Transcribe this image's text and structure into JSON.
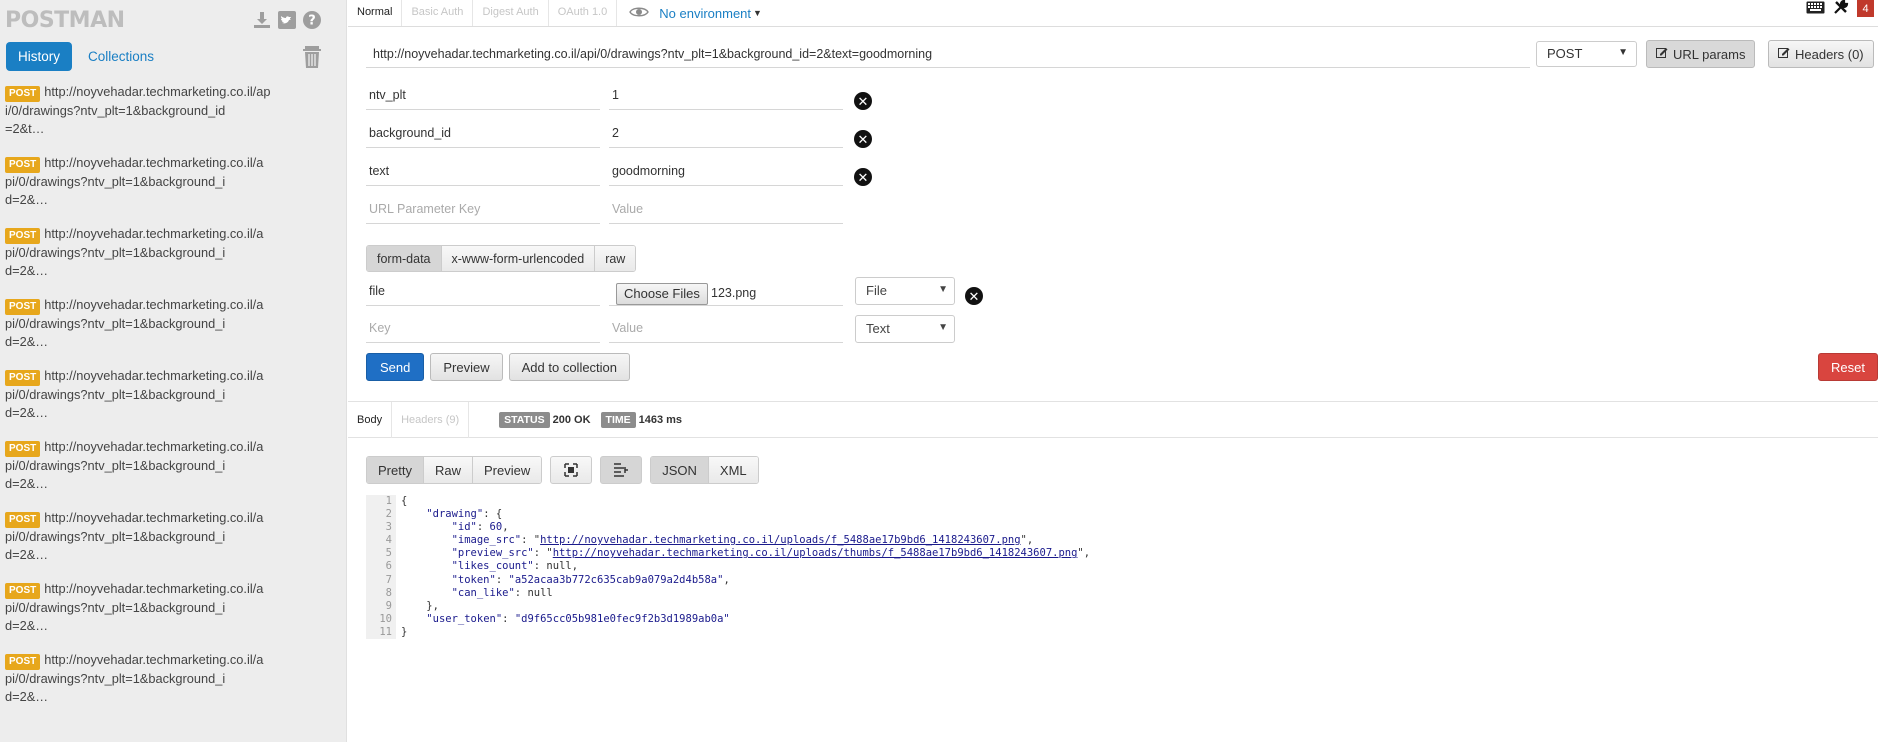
{
  "sidebar": {
    "logo": "POSTMAN",
    "tabs": {
      "history": "History",
      "collections": "Collections"
    },
    "items": [
      {
        "method": "POST",
        "lines": [
          "http://noyvehadar.techmarketing.co.il/ap",
          "i/0/drawings?ntv_plt=1&background_id",
          "=2&t…"
        ]
      },
      {
        "method": "POST",
        "lines": [
          "http://noyvehadar.techmarketing.co.il/a",
          "pi/0/drawings?ntv_plt=1&background_i",
          "d=2&…"
        ]
      },
      {
        "method": "POST",
        "lines": [
          "http://noyvehadar.techmarketing.co.il/a",
          "pi/0/drawings?ntv_plt=1&background_i",
          "d=2&…"
        ]
      },
      {
        "method": "POST",
        "lines": [
          "http://noyvehadar.techmarketing.co.il/a",
          "pi/0/drawings?ntv_plt=1&background_i",
          "d=2&…"
        ]
      },
      {
        "method": "POST",
        "lines": [
          "http://noyvehadar.techmarketing.co.il/a",
          "pi/0/drawings?ntv_plt=1&background_i",
          "d=2&…"
        ]
      },
      {
        "method": "POST",
        "lines": [
          "http://noyvehadar.techmarketing.co.il/a",
          "pi/0/drawings?ntv_plt=1&background_i",
          "d=2&…"
        ]
      },
      {
        "method": "POST",
        "lines": [
          "http://noyvehadar.techmarketing.co.il/a",
          "pi/0/drawings?ntv_plt=1&background_i",
          "d=2&…"
        ]
      },
      {
        "method": "POST",
        "lines": [
          "http://noyvehadar.techmarketing.co.il/a",
          "pi/0/drawings?ntv_plt=1&background_i",
          "d=2&…"
        ]
      },
      {
        "method": "POST",
        "lines": [
          "http://noyvehadar.techmarketing.co.il/a",
          "pi/0/drawings?ntv_plt=1&background_i",
          "d=2&…"
        ]
      }
    ]
  },
  "auth_tabs": [
    "Normal",
    "Basic Auth",
    "Digest Auth",
    "OAuth 1.0"
  ],
  "environment": "No environment",
  "notification_count": "4",
  "request": {
    "url": "http://noyvehadar.techmarketing.co.il/api/0/drawings?ntv_plt=1&background_id=2&text=goodmorning",
    "method": "POST",
    "url_params_label": "URL params",
    "headers_label": "Headers (0)",
    "params": [
      {
        "key": "ntv_plt",
        "value": "1"
      },
      {
        "key": "background_id",
        "value": "2"
      },
      {
        "key": "text",
        "value": "goodmorning"
      }
    ],
    "param_key_placeholder": "URL Parameter Key",
    "param_value_placeholder": "Value",
    "body_tabs": [
      "form-data",
      "x-www-form-urlencoded",
      "raw"
    ],
    "form_rows": {
      "file_key": "file",
      "choose_files_label": "Choose Files",
      "file_name": "123.png",
      "file_type": "File",
      "key_placeholder": "Key",
      "value_placeholder": "Value",
      "text_type": "Text"
    },
    "actions": {
      "send": "Send",
      "preview": "Preview",
      "add_to_collection": "Add to collection",
      "reset": "Reset"
    }
  },
  "response": {
    "tabs": {
      "body": "Body",
      "headers": "Headers (9)"
    },
    "status_label": "STATUS",
    "status_value": "200 OK",
    "time_label": "TIME",
    "time_value": "1463 ms",
    "view_modes": [
      "Pretty",
      "Raw",
      "Preview"
    ],
    "formats": [
      "JSON",
      "XML"
    ],
    "line_numbers": [
      "1",
      "2",
      "3",
      "4",
      "5",
      "6",
      "7",
      "8",
      "9",
      "10",
      "11"
    ],
    "code": {
      "l1": "{",
      "l2_key": "\"drawing\"",
      "l2_rest": ": {",
      "l3_key": "\"id\"",
      "l3_val": "60",
      "l4_key": "\"image_src\"",
      "l4_val": "http://noyvehadar.techmarketing.co.il/uploads/f_5488ae17b9bd6_1418243607.png",
      "l5_key": "\"preview_src\"",
      "l5_val": "http://noyvehadar.techmarketing.co.il/uploads/thumbs/f_5488ae17b9bd6_1418243607.png",
      "l6_key": "\"likes_count\"",
      "l6_val": "null",
      "l7_key": "\"token\"",
      "l7_val": "\"a52acaa3b772c635cab9a079a2d4b58a\"",
      "l8_key": "\"can_like\"",
      "l8_val": "null",
      "l9": "},",
      "l10_key": "\"user_token\"",
      "l10_val": "\"d9f65cc05b981e0fec9f2b3d1989ab0a\"",
      "l11": "}"
    }
  },
  "colors": {
    "accent": "#1a7fc4",
    "post_badge": "#e7a71c",
    "send": "#1f6fc5",
    "reset": "#d9453f"
  },
  "icons": [
    "download-icon",
    "twitter-icon",
    "help-icon",
    "trash-icon",
    "eye-icon",
    "keyboard-icon",
    "tools-icon",
    "delete-icon",
    "fullscreen-icon",
    "wrap-icon"
  ]
}
